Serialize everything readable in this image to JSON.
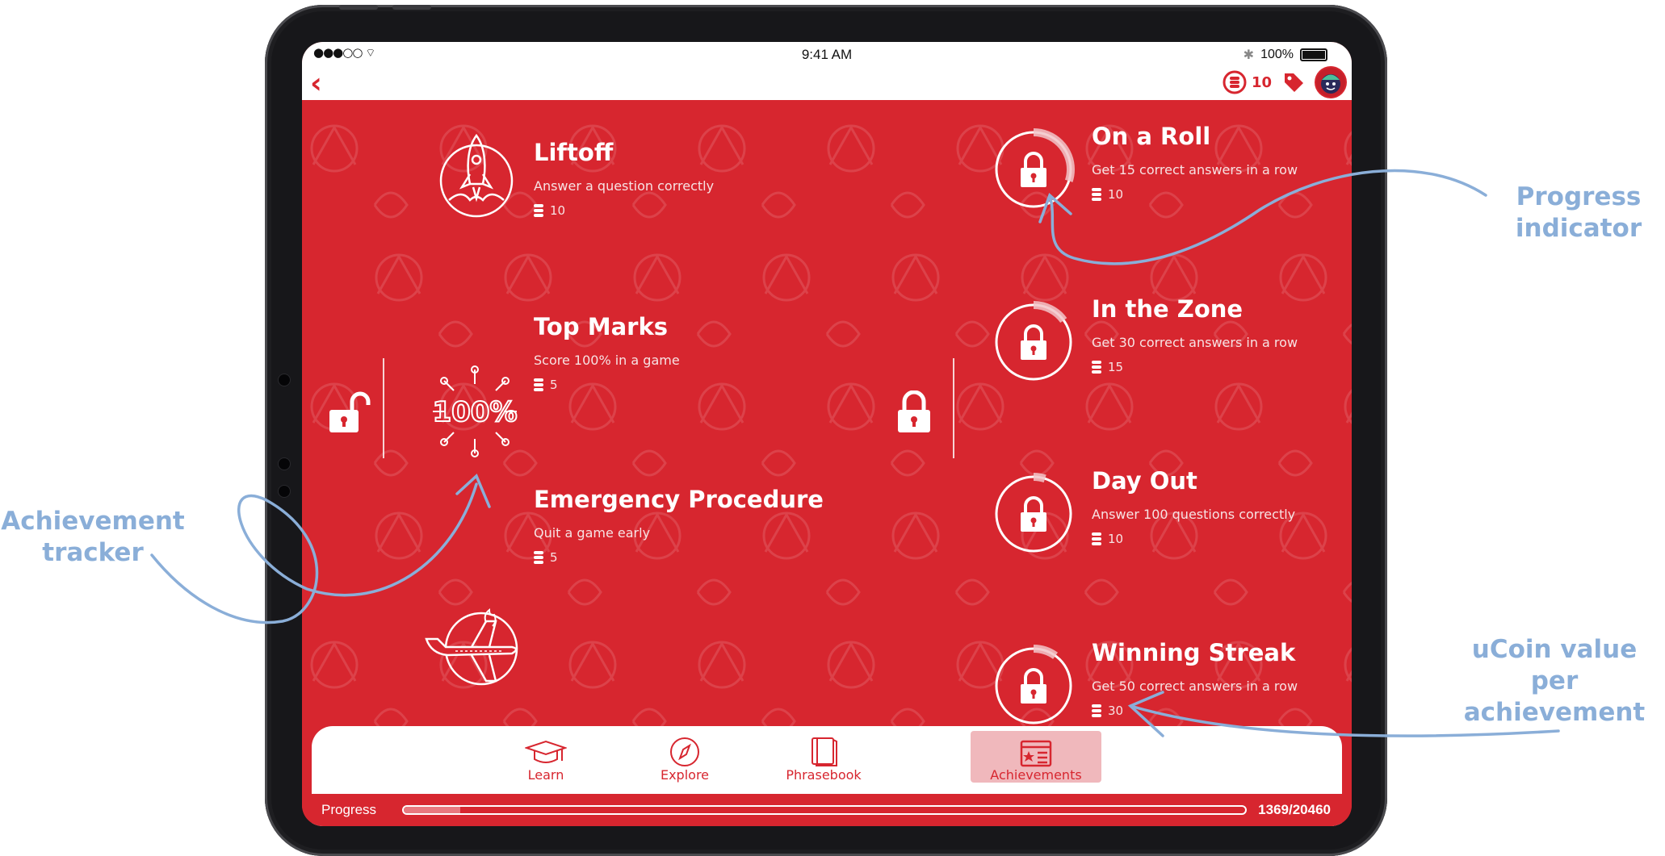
{
  "annotations": {
    "progress_indicator": "Progress\nindicator",
    "achievement_tracker": "Achievement\ntracker",
    "ucoin_value": "uCoin value per\nachievement"
  },
  "statusbar": {
    "time": "9:41 AM",
    "battery": "100%"
  },
  "header": {
    "coins": "10"
  },
  "achievements_unlocked": [
    {
      "title": "Liftoff",
      "desc": "Answer a question correctly",
      "coins": "10",
      "icon": "rocket-icon"
    },
    {
      "title": "Top Marks",
      "desc": "Score 100% in a game",
      "coins": "5",
      "icon": "100-percent-icon",
      "badge_text": "100%"
    },
    {
      "title": "Emergency Procedure",
      "desc": "Quit a game early",
      "coins": "5",
      "icon": "plane-icon"
    }
  ],
  "achievements_locked": [
    {
      "title": "On a Roll",
      "desc": "Get 15 correct answers in a row",
      "coins": "10",
      "progress": 0.3
    },
    {
      "title": "In the Zone",
      "desc": "Get 30 correct answers in a row",
      "coins": "15",
      "progress": 0.15
    },
    {
      "title": "Day Out",
      "desc": "Answer 100 questions correctly",
      "coins": "10",
      "progress": 0.05
    },
    {
      "title": "Winning Streak",
      "desc": "Get 50 correct answers in a row",
      "coins": "30",
      "progress": 0.1
    }
  ],
  "tabs": [
    {
      "label": "Learn",
      "icon": "graduation-cap-icon",
      "active": false
    },
    {
      "label": "Explore",
      "icon": "compass-icon",
      "active": false
    },
    {
      "label": "Phrasebook",
      "icon": "book-icon",
      "active": false
    },
    {
      "label": "Achievements",
      "icon": "certificate-icon",
      "active": true
    }
  ],
  "progress": {
    "label": "Progress",
    "count": "1369/20460",
    "fraction": 0.0669
  },
  "colors": {
    "primary": "#d7262f",
    "annotation": "#8aaed8",
    "active_tab": "#f0b8bc"
  }
}
